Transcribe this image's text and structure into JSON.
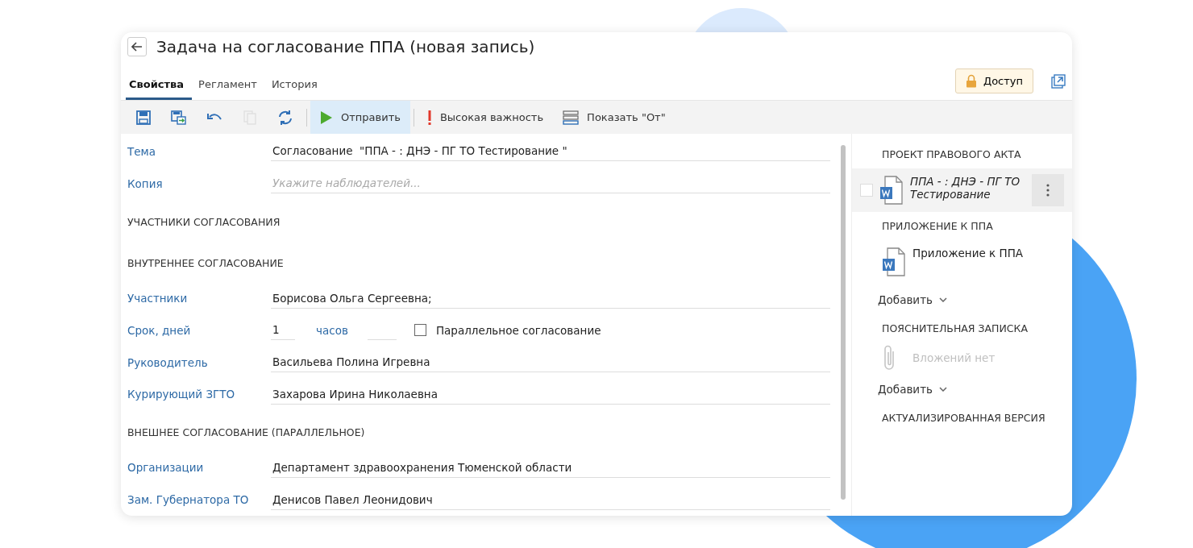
{
  "window": {
    "title": "Задача на согласование ППА (новая запись)"
  },
  "tabs": [
    {
      "label": "Свойства",
      "selected": true
    },
    {
      "label": "Регламент",
      "selected": false
    },
    {
      "label": "История",
      "selected": false
    }
  ],
  "access_button": {
    "label": "Доступ"
  },
  "toolbar": [
    {
      "kind": "save",
      "disabled": false
    },
    {
      "kind": "save-copy",
      "disabled": false
    },
    {
      "kind": "undo",
      "disabled": false
    },
    {
      "kind": "copy",
      "disabled": true
    },
    {
      "kind": "refresh",
      "disabled": false
    },
    {
      "kind": "send",
      "label": "Отправить",
      "highlighted": true,
      "disabled": false
    },
    {
      "kind": "importance",
      "label": "Высокая важность",
      "highlighted": false,
      "disabled": false
    },
    {
      "kind": "show-from",
      "label": "Показать \"От\"",
      "highlighted": false,
      "disabled": false
    }
  ],
  "form": [
    {
      "kind": "field",
      "label": "Тема",
      "value": "Согласование  \"ППА - : ДНЭ - ПГ ТО Тестирование \""
    },
    {
      "kind": "field",
      "label": "Копия",
      "placeholder": "Укажите наблюдателей..."
    },
    {
      "kind": "section",
      "title": "УЧАСТНИКИ СОГЛАСОВАНИЯ"
    },
    {
      "kind": "section",
      "title": "ВНУТРЕННЕЕ СОГЛАСОВАНИЕ"
    },
    {
      "kind": "field",
      "label": "Участники",
      "value": "Борисова Ольга Сергеевна;"
    },
    {
      "kind": "term",
      "label": "Срок, дней",
      "value": "1",
      "unit": "часов",
      "checkbox_label": "Параллельное согласование",
      "checked": false
    },
    {
      "kind": "field",
      "label": "Руководитель",
      "value": "Васильева Полина Игревна"
    },
    {
      "kind": "field",
      "label": "Курирующий ЗГТО",
      "value": "Захарова Ирина Николаевна"
    },
    {
      "kind": "section",
      "title": "ВНЕШНЕЕ СОГЛАСОВАНИЕ (ПАРАЛЛЕЛЬНОЕ)"
    },
    {
      "kind": "field",
      "label": "Организации",
      "value": "Департамент здравоохранения Тюменской области"
    },
    {
      "kind": "field",
      "label": "Зам. Губернатора ТО",
      "value": "Денисов Павел Леонидович"
    }
  ],
  "attachments": [
    {
      "title": "ПРОЕКТ ПРАВОВОГО АКТА",
      "files": [
        {
          "name": "ППА - : ДНЭ - ПГ ТО Тестирование",
          "italic": true,
          "highlighted": true,
          "checked": false
        }
      ]
    },
    {
      "title": "ПРИЛОЖЕНИЕ К ППА",
      "files": [
        {
          "name": "Приложение к ППА",
          "italic": false,
          "highlighted": false
        }
      ],
      "add_label": "Добавить"
    },
    {
      "title": "ПОЯСНИТЕЛЬНАЯ ЗАПИСКА",
      "empty_text": "Вложений нет",
      "add_label": "Добавить"
    },
    {
      "title": "АКТУАЛИЗИРОВАННАЯ ВЕРСИЯ"
    }
  ]
}
